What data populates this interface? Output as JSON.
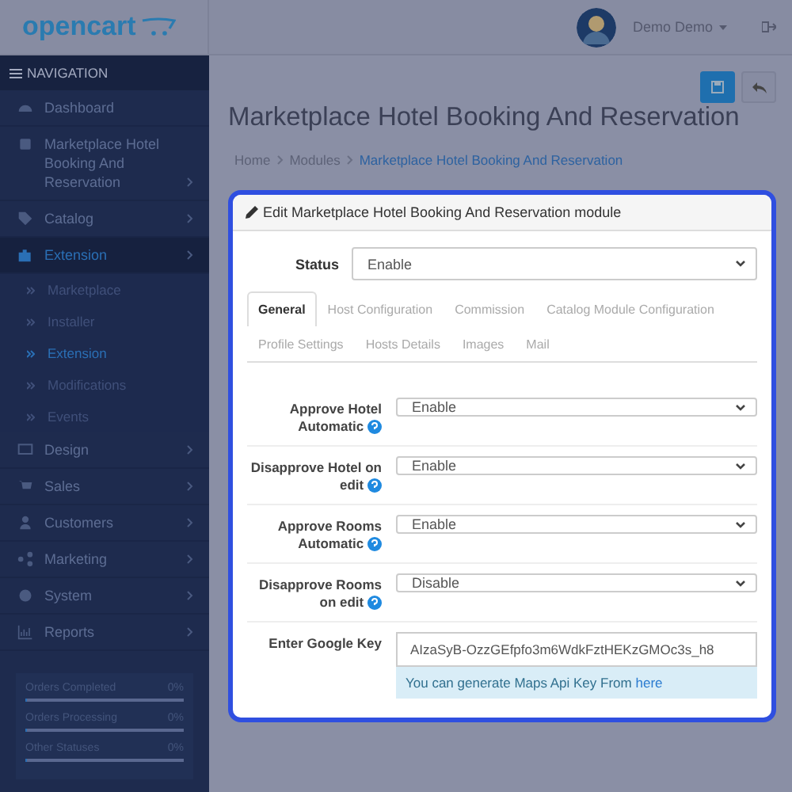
{
  "header": {
    "logo": "opencart",
    "user": "Demo Demo"
  },
  "navigation": {
    "title": "NAVIGATION",
    "items": [
      {
        "label": "Dashboard",
        "selected": false,
        "has_arrow": false
      },
      {
        "label": "Marketplace Hotel Booking And Reservation",
        "selected": false,
        "has_arrow": true
      },
      {
        "label": "Catalog",
        "selected": false,
        "has_arrow": true
      },
      {
        "label": "Extension",
        "selected": true,
        "has_arrow": true,
        "children": [
          {
            "label": "Marketplace",
            "selected": false
          },
          {
            "label": "Installer",
            "selected": false
          },
          {
            "label": "Extension",
            "selected": true
          },
          {
            "label": "Modifications",
            "selected": false
          },
          {
            "label": "Events",
            "selected": false
          }
        ]
      },
      {
        "label": "Design",
        "selected": false,
        "has_arrow": true
      },
      {
        "label": "Sales",
        "selected": false,
        "has_arrow": true
      },
      {
        "label": "Customers",
        "selected": false,
        "has_arrow": true
      },
      {
        "label": "Marketing",
        "selected": false,
        "has_arrow": true
      },
      {
        "label": "System",
        "selected": false,
        "has_arrow": true
      },
      {
        "label": "Reports",
        "selected": false,
        "has_arrow": true
      }
    ]
  },
  "stats": [
    {
      "label": "Orders Completed",
      "value": "0%",
      "level": 0
    },
    {
      "label": "Orders Processing",
      "value": "0%",
      "level": 0
    },
    {
      "label": "Other Statuses",
      "value": "0%",
      "level": 0
    }
  ],
  "page": {
    "title": "Marketplace Hotel Booking And Reservation",
    "breadcrumbs": [
      {
        "label": "Home",
        "current": false
      },
      {
        "label": "Modules",
        "current": false
      },
      {
        "label": "Marketplace Hotel Booking And Reservation",
        "current": true
      }
    ]
  },
  "panel": {
    "heading": "Edit Marketplace Hotel Booking And Reservation module",
    "status": {
      "label": "Status",
      "value": "Enable"
    },
    "tabs": [
      {
        "label": "General",
        "selected": true
      },
      {
        "label": "Host Configuration",
        "selected": false
      },
      {
        "label": "Commission",
        "selected": false
      },
      {
        "label": "Catalog Module Configuration",
        "selected": false
      },
      {
        "label": "Profile Settings",
        "selected": false
      },
      {
        "label": "Hosts Details",
        "selected": false
      },
      {
        "label": "Images",
        "selected": false
      },
      {
        "label": "Mail",
        "selected": false
      }
    ],
    "fields": [
      {
        "kind": "select",
        "label": "Approve Hotel Automatic",
        "value": "Enable",
        "help": true
      },
      {
        "kind": "select",
        "label": "Disapprove Hotel on edit",
        "value": "Enable",
        "help": true
      },
      {
        "kind": "select",
        "label": "Approve Rooms Automatic",
        "value": "Enable",
        "help": true
      },
      {
        "kind": "select",
        "label": "Disapprove Rooms on edit",
        "value": "Disable",
        "help": true
      },
      {
        "kind": "input",
        "label": "Enter Google Key",
        "value": "AIzaSyB-OzzGEfpfo3m6WdkFztHEKzGMOc3s_h8",
        "help": false,
        "note": "You can generate Maps Api Key From",
        "note_link": "here"
      }
    ]
  }
}
